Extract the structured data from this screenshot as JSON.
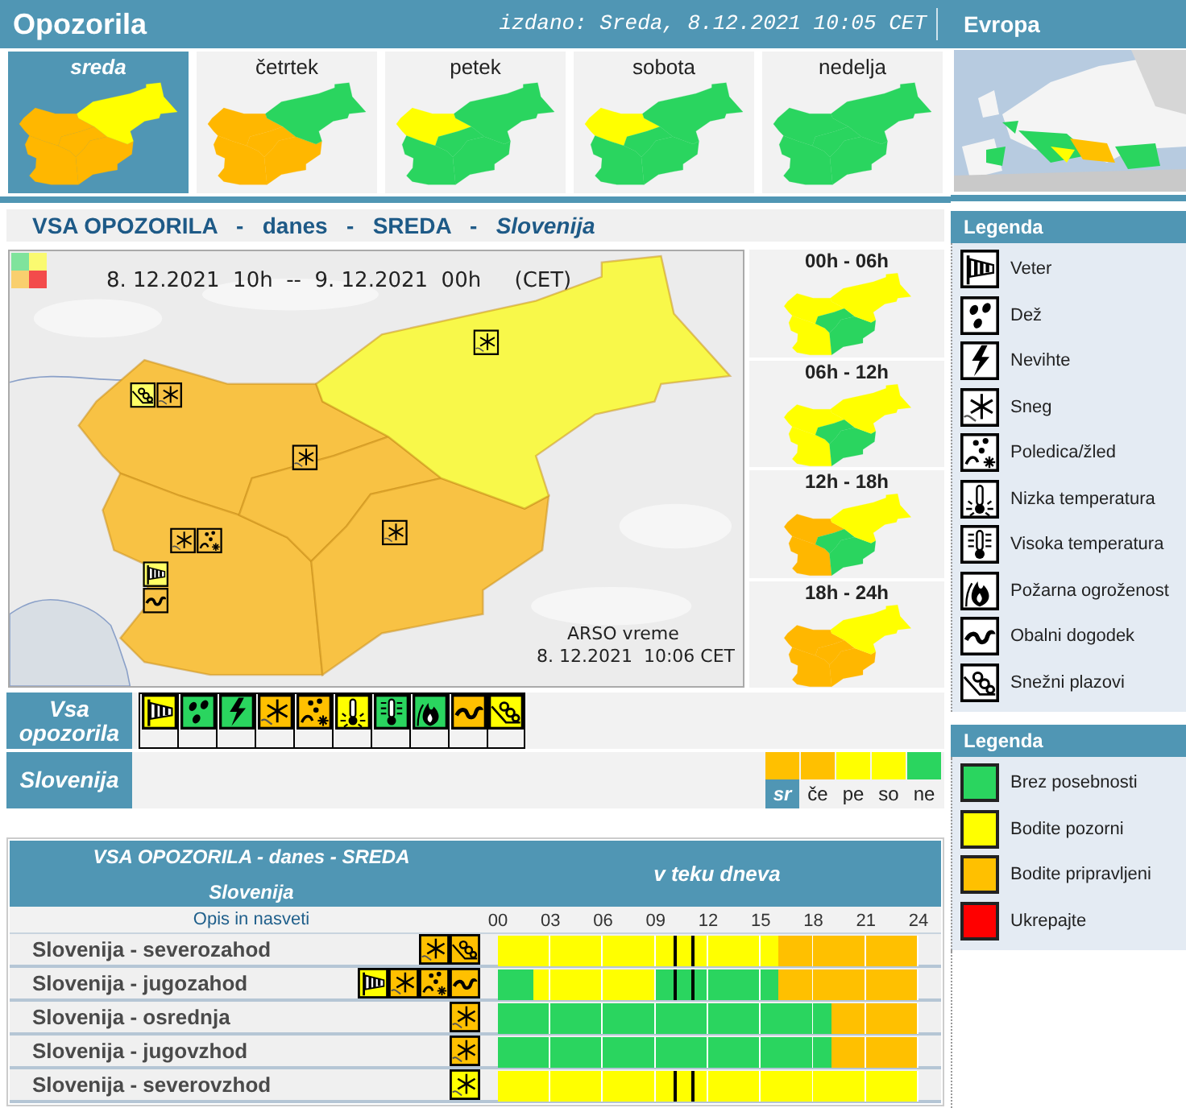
{
  "header": {
    "title": "Opozorila",
    "issued": "izdano: Sreda, 8.12.2021 10:05 CET"
  },
  "days": [
    {
      "label": "sreda",
      "selected": true,
      "regions": [
        {
          "color": "#ffb700"
        },
        {
          "color": "#ffb700"
        },
        {
          "color": "#ffb700"
        },
        {
          "color": "#ffb700"
        },
        {
          "color": "#ffff00"
        }
      ]
    },
    {
      "label": "četrtek",
      "selected": false,
      "regions": [
        {
          "color": "#ffb700"
        },
        {
          "color": "#ffb700"
        },
        {
          "color": "#ffb700"
        },
        {
          "color": "#ffb700"
        },
        {
          "color": "#2ad55f"
        }
      ]
    },
    {
      "label": "petek",
      "selected": false,
      "regions": [
        {
          "color": "#ffff00"
        },
        {
          "color": "#2ad55f"
        },
        {
          "color": "#2ad55f"
        },
        {
          "color": "#2ad55f"
        },
        {
          "color": "#2ad55f"
        }
      ]
    },
    {
      "label": "sobota",
      "selected": false,
      "regions": [
        {
          "color": "#ffff00"
        },
        {
          "color": "#2ad55f"
        },
        {
          "color": "#2ad55f"
        },
        {
          "color": "#2ad55f"
        },
        {
          "color": "#2ad55f"
        }
      ]
    },
    {
      "label": "nedelja",
      "selected": false,
      "regions": [
        {
          "color": "#2ad55f"
        },
        {
          "color": "#2ad55f"
        },
        {
          "color": "#2ad55f"
        },
        {
          "color": "#2ad55f"
        },
        {
          "color": "#2ad55f"
        }
      ]
    }
  ],
  "europe": {
    "title": "Evropa",
    "kind": "picture"
  },
  "summary_title": "VSA OPOZORILA   -   danes   -   SREDA   -   *Slovenija*",
  "main_map": {
    "period": "8. 12.2021  10h  --  9. 12.2021  00h     (CET)",
    "credit": "ARSO vreme",
    "timestamp": "8. 12.2021  10:06 CET",
    "regions": [
      {
        "color": "#f8c244",
        "icons": [
          {
            "kind": "avalanche",
            "color": "#ffff66"
          },
          {
            "kind": "snow",
            "color": "#f8c244"
          }
        ]
      },
      {
        "color": "#f8c244",
        "icons": [
          {
            "kind": "snow",
            "color": "#f8c244"
          },
          {
            "kind": "ice",
            "color": "#f8c244"
          }
        ]
      },
      {
        "color": "#f8c244",
        "icons": [
          {
            "kind": "snow",
            "color": "#f8c244"
          }
        ]
      },
      {
        "color": "#f8c244",
        "icons": [
          {
            "kind": "snow",
            "color": "#f8c244"
          }
        ]
      },
      {
        "color": "#f8f84a",
        "icons": [
          {
            "kind": "snow",
            "color": "#f8f84a"
          }
        ]
      }
    ],
    "coast_icons": [
      {
        "kind": "wind",
        "color": "#ffff66"
      },
      {
        "kind": "coastal",
        "color": "#f8c244"
      }
    ]
  },
  "periods": [
    {
      "label": "00h - 06h",
      "regions": [
        {
          "color": "#ffff00"
        },
        {
          "color": "#ffff00"
        },
        {
          "color": "#2ad55f"
        },
        {
          "color": "#2ad55f"
        },
        {
          "color": "#ffff00"
        }
      ]
    },
    {
      "label": "06h - 12h",
      "regions": [
        {
          "color": "#ffff00"
        },
        {
          "color": "#ffff00"
        },
        {
          "color": "#2ad55f"
        },
        {
          "color": "#2ad55f"
        },
        {
          "color": "#ffff00"
        }
      ]
    },
    {
      "label": "12h - 18h",
      "regions": [
        {
          "color": "#ffb700"
        },
        {
          "color": "#ffb700"
        },
        {
          "color": "#2ad55f"
        },
        {
          "color": "#2ad55f"
        },
        {
          "color": "#ffff00"
        }
      ]
    },
    {
      "label": "18h - 24h",
      "regions": [
        {
          "color": "#ffb700"
        },
        {
          "color": "#ffb700"
        },
        {
          "color": "#ffb700"
        },
        {
          "color": "#ffb700"
        },
        {
          "color": "#ffff00"
        }
      ]
    }
  ],
  "all_warnings": {
    "label": "Vsa opozorila",
    "icons": [
      {
        "kind": "wind",
        "color": "#ffff00"
      },
      {
        "kind": "rain",
        "color": "#2ad55f"
      },
      {
        "kind": "thunder",
        "color": "#2ad55f"
      },
      {
        "kind": "snow",
        "color": "#ffc000"
      },
      {
        "kind": "ice",
        "color": "#ffc000"
      },
      {
        "kind": "cold",
        "color": "#ffff00"
      },
      {
        "kind": "heat",
        "color": "#2ad55f"
      },
      {
        "kind": "fire",
        "color": "#2ad55f"
      },
      {
        "kind": "coastal",
        "color": "#ffc000"
      },
      {
        "kind": "avalanche",
        "color": "#ffff00"
      }
    ]
  },
  "country_row": {
    "label": "Slovenija",
    "days": [
      {
        "label": "sr",
        "color": "#ffc000",
        "selected": true
      },
      {
        "label": "če",
        "color": "#ffc000",
        "selected": false
      },
      {
        "label": "pe",
        "color": "#ffff00",
        "selected": false
      },
      {
        "label": "so",
        "color": "#ffff00",
        "selected": false
      },
      {
        "label": "ne",
        "color": "#2ad55f",
        "selected": false
      }
    ]
  },
  "table": {
    "title": "VSA OPOZORILA - danes - SREDA",
    "subtitle": "Slovenija",
    "timeline_title": "v teku dneva",
    "link": "Opis in nasveti",
    "ticks": [
      "00",
      "03",
      "06",
      "09",
      "12",
      "15",
      "18",
      "21",
      "24"
    ],
    "rows": [
      {
        "name": "Slovenija - severozahod",
        "now_marker": true,
        "icons": [
          {
            "kind": "snow",
            "color": "#ffc000"
          },
          {
            "kind": "avalanche",
            "color": "#ffc000"
          }
        ],
        "hours": [
          {
            "color": "#ffff00"
          },
          {
            "color": "#ffff00"
          },
          {
            "color": "#ffff00"
          },
          {
            "color": "#ffff00"
          },
          {
            "color": "#ffff00"
          },
          {
            "color": "#ffff00"
          },
          {
            "color": "#ffff00"
          },
          {
            "color": "#ffff00"
          },
          {
            "color": "#ffff00"
          },
          {
            "color": "#ffff00"
          },
          {
            "color": "#ffff00"
          },
          {
            "color": "#ffff00"
          },
          {
            "color": "#ffff00"
          },
          {
            "color": "#ffff00"
          },
          {
            "color": "#ffff00"
          },
          {
            "color": "#ffff00"
          },
          {
            "color": "#ffc000"
          },
          {
            "color": "#ffc000"
          },
          {
            "color": "#ffc000"
          },
          {
            "color": "#ffc000"
          },
          {
            "color": "#ffc000"
          },
          {
            "color": "#ffc000"
          },
          {
            "color": "#ffc000"
          },
          {
            "color": "#ffc000"
          }
        ]
      },
      {
        "name": "Slovenija - jugozahod",
        "now_marker": true,
        "icons": [
          {
            "kind": "wind",
            "color": "#ffff00"
          },
          {
            "kind": "snow",
            "color": "#ffc000"
          },
          {
            "kind": "ice",
            "color": "#ffc000"
          },
          {
            "kind": "coastal",
            "color": "#ffc000"
          }
        ],
        "hours": [
          {
            "color": "#2ad55f"
          },
          {
            "color": "#2ad55f"
          },
          {
            "color": "#ffff00"
          },
          {
            "color": "#ffff00"
          },
          {
            "color": "#ffff00"
          },
          {
            "color": "#ffff00"
          },
          {
            "color": "#ffff00"
          },
          {
            "color": "#ffff00"
          },
          {
            "color": "#ffff00"
          },
          {
            "color": "#2ad55f"
          },
          {
            "color": "#2ad55f"
          },
          {
            "color": "#2ad55f"
          },
          {
            "color": "#2ad55f"
          },
          {
            "color": "#2ad55f"
          },
          {
            "color": "#2ad55f"
          },
          {
            "color": "#2ad55f"
          },
          {
            "color": "#ffc000"
          },
          {
            "color": "#ffc000"
          },
          {
            "color": "#ffc000"
          },
          {
            "color": "#ffc000"
          },
          {
            "color": "#ffc000"
          },
          {
            "color": "#ffc000"
          },
          {
            "color": "#ffc000"
          },
          {
            "color": "#ffc000"
          }
        ]
      },
      {
        "name": "Slovenija - osrednja",
        "now_marker": false,
        "icons": [
          {
            "kind": "snow",
            "color": "#ffc000"
          }
        ],
        "hours": [
          {
            "color": "#2ad55f"
          },
          {
            "color": "#2ad55f"
          },
          {
            "color": "#2ad55f"
          },
          {
            "color": "#2ad55f"
          },
          {
            "color": "#2ad55f"
          },
          {
            "color": "#2ad55f"
          },
          {
            "color": "#2ad55f"
          },
          {
            "color": "#2ad55f"
          },
          {
            "color": "#2ad55f"
          },
          {
            "color": "#2ad55f"
          },
          {
            "color": "#2ad55f"
          },
          {
            "color": "#2ad55f"
          },
          {
            "color": "#2ad55f"
          },
          {
            "color": "#2ad55f"
          },
          {
            "color": "#2ad55f"
          },
          {
            "color": "#2ad55f"
          },
          {
            "color": "#2ad55f"
          },
          {
            "color": "#2ad55f"
          },
          {
            "color": "#2ad55f"
          },
          {
            "color": "#ffc000"
          },
          {
            "color": "#ffc000"
          },
          {
            "color": "#ffc000"
          },
          {
            "color": "#ffc000"
          },
          {
            "color": "#ffc000"
          }
        ]
      },
      {
        "name": "Slovenija - jugovzhod",
        "now_marker": false,
        "icons": [
          {
            "kind": "snow",
            "color": "#ffc000"
          }
        ],
        "hours": [
          {
            "color": "#2ad55f"
          },
          {
            "color": "#2ad55f"
          },
          {
            "color": "#2ad55f"
          },
          {
            "color": "#2ad55f"
          },
          {
            "color": "#2ad55f"
          },
          {
            "color": "#2ad55f"
          },
          {
            "color": "#2ad55f"
          },
          {
            "color": "#2ad55f"
          },
          {
            "color": "#2ad55f"
          },
          {
            "color": "#2ad55f"
          },
          {
            "color": "#2ad55f"
          },
          {
            "color": "#2ad55f"
          },
          {
            "color": "#2ad55f"
          },
          {
            "color": "#2ad55f"
          },
          {
            "color": "#2ad55f"
          },
          {
            "color": "#2ad55f"
          },
          {
            "color": "#2ad55f"
          },
          {
            "color": "#2ad55f"
          },
          {
            "color": "#2ad55f"
          },
          {
            "color": "#ffc000"
          },
          {
            "color": "#ffc000"
          },
          {
            "color": "#ffc000"
          },
          {
            "color": "#ffc000"
          },
          {
            "color": "#ffc000"
          }
        ]
      },
      {
        "name": "Slovenija - severovzhod",
        "now_marker": true,
        "icons": [
          {
            "kind": "snow",
            "color": "#ffff00"
          }
        ],
        "hours": [
          {
            "color": "#ffff00"
          },
          {
            "color": "#ffff00"
          },
          {
            "color": "#ffff00"
          },
          {
            "color": "#ffff00"
          },
          {
            "color": "#ffff00"
          },
          {
            "color": "#ffff00"
          },
          {
            "color": "#ffff00"
          },
          {
            "color": "#ffff00"
          },
          {
            "color": "#ffff00"
          },
          {
            "color": "#ffff00"
          },
          {
            "color": "#ffff00"
          },
          {
            "color": "#ffff00"
          },
          {
            "color": "#ffff00"
          },
          {
            "color": "#ffff00"
          },
          {
            "color": "#ffff00"
          },
          {
            "color": "#ffff00"
          },
          {
            "color": "#ffff00"
          },
          {
            "color": "#ffff00"
          },
          {
            "color": "#ffff00"
          },
          {
            "color": "#ffff00"
          },
          {
            "color": "#ffff00"
          },
          {
            "color": "#ffff00"
          },
          {
            "color": "#ffff00"
          },
          {
            "color": "#ffff00"
          }
        ]
      }
    ]
  },
  "legend": {
    "title": "Legenda",
    "items": [
      {
        "kind": "wind",
        "label": "Veter"
      },
      {
        "kind": "rain",
        "label": "Dež"
      },
      {
        "kind": "thunder",
        "label": "Nevihte"
      },
      {
        "kind": "snow",
        "label": "Sneg"
      },
      {
        "kind": "ice",
        "label": "Poledica/žled"
      },
      {
        "kind": "cold",
        "label": "Nizka temperatura"
      },
      {
        "kind": "heat",
        "label": "Visoka temperatura"
      },
      {
        "kind": "fire",
        "label": "Požarna ogroženost"
      },
      {
        "kind": "coastal",
        "label": "Obalni dogodek"
      },
      {
        "kind": "avalanche",
        "label": "Snežni plazovi"
      }
    ]
  },
  "levels": {
    "title": "Legenda",
    "items": [
      {
        "color": "#2ad55f",
        "label": "Brez posebnosti"
      },
      {
        "color": "#ffff00",
        "label": "Bodite pozorni"
      },
      {
        "color": "#ffc000",
        "label": "Bodite pripravljeni"
      },
      {
        "color": "#ff0000",
        "label": "Ukrepajte"
      }
    ]
  }
}
